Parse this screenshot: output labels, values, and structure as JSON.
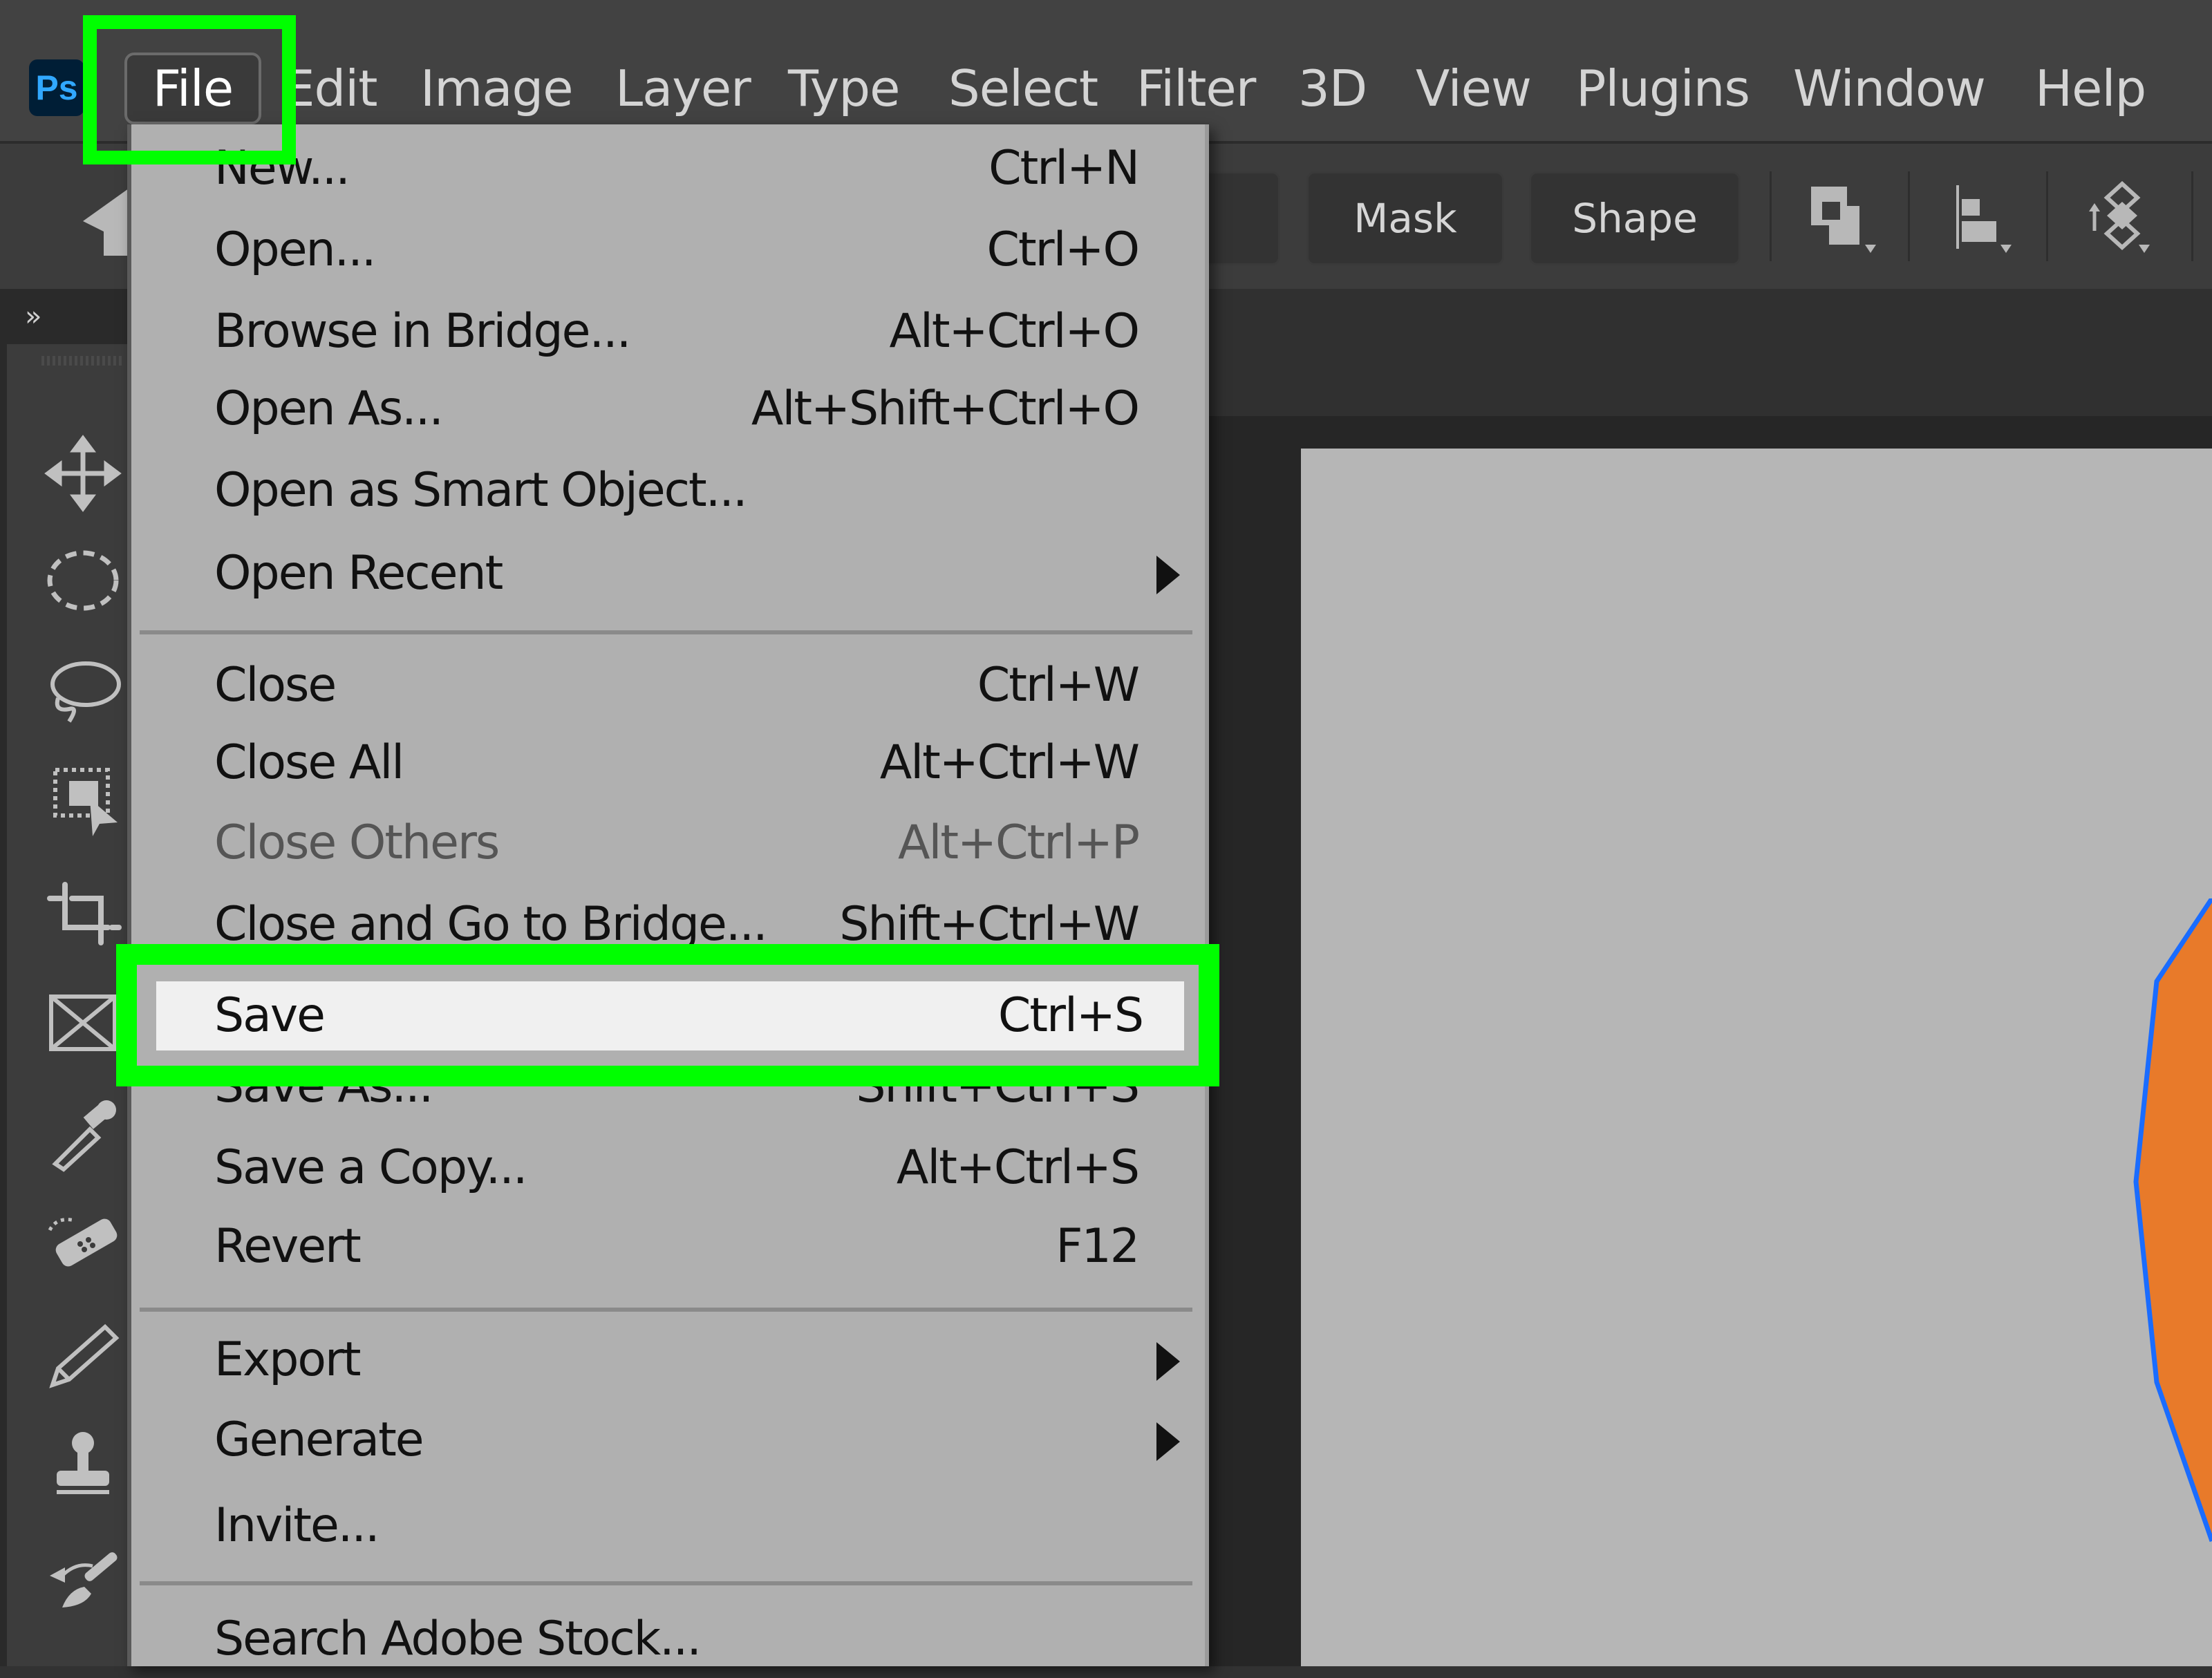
{
  "app": {
    "logo_text": "Ps",
    "accent_color": "#31a8ff",
    "highlight_color": "#00ff00"
  },
  "menubar": {
    "items": [
      "File",
      "Edit",
      "Image",
      "Layer",
      "Type",
      "Select",
      "Filter",
      "3D",
      "View",
      "Plugins",
      "Window",
      "Help"
    ],
    "active": "File"
  },
  "optionsbar": {
    "mask_label": "Mask",
    "shape_label": "Shape",
    "icons": [
      "path-operations-icon",
      "path-alignment-icon",
      "path-arrangement-icon"
    ]
  },
  "panel": {
    "collapse_label": "»"
  },
  "toolbar": {
    "tools": [
      "move-tool",
      "elliptical-marquee-tool",
      "lasso-tool",
      "object-selection-tool",
      "crop-tool",
      "frame-tool",
      "eyedropper-tool",
      "healing-brush-tool",
      "pencil-tool",
      "clone-stamp-tool",
      "history-brush-tool"
    ]
  },
  "file_menu": {
    "groups": [
      [
        {
          "label": "New...",
          "shortcut": "Ctrl+N"
        },
        {
          "label": "Open...",
          "shortcut": "Ctrl+O"
        },
        {
          "label": "Browse in Bridge...",
          "shortcut": "Alt+Ctrl+O"
        },
        {
          "label": "Open As...",
          "shortcut": "Alt+Shift+Ctrl+O"
        },
        {
          "label": "Open as Smart Object...",
          "shortcut": ""
        },
        {
          "label": "Open Recent",
          "shortcut": "",
          "submenu": true
        }
      ],
      [
        {
          "label": "Close",
          "shortcut": "Ctrl+W"
        },
        {
          "label": "Close All",
          "shortcut": "Alt+Ctrl+W"
        },
        {
          "label": "Close Others",
          "shortcut": "Alt+Ctrl+P",
          "disabled": true
        },
        {
          "label": "Close and Go to Bridge...",
          "shortcut": "Shift+Ctrl+W"
        },
        {
          "label": "Save",
          "shortcut": "Ctrl+S",
          "highlighted": true
        },
        {
          "label": "Save As...",
          "shortcut": "Shift+Ctrl+S"
        },
        {
          "label": "Save a Copy...",
          "shortcut": "Alt+Ctrl+S"
        },
        {
          "label": "Revert",
          "shortcut": "F12"
        }
      ],
      [
        {
          "label": "Export",
          "shortcut": "",
          "submenu": true
        },
        {
          "label": "Generate",
          "shortcut": "",
          "submenu": true
        },
        {
          "label": "Invite...",
          "shortcut": ""
        }
      ],
      [
        {
          "label": "Search Adobe Stock...",
          "shortcut": ""
        }
      ]
    ]
  },
  "canvas": {
    "shape_fill": "#e87a2a",
    "shape_outline": "#1a6cff"
  }
}
